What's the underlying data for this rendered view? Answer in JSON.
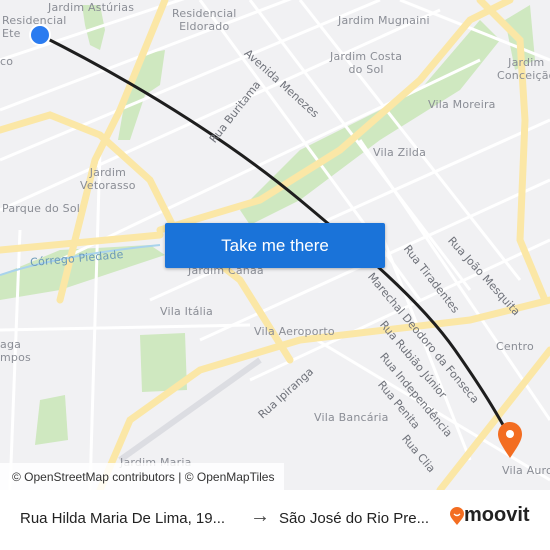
{
  "map": {
    "labels": {
      "residencial_ete": "Residencial\nEte",
      "jardim_asturias": "Jardim Astúrias",
      "residencial_eldorado": "Residencial\nEldorado",
      "jardim_mugnaini": "Jardim Mugnaini",
      "jardim_costa_do_sol": "Jardim Costa\ndo Sol",
      "jardim_conceicao": "Jardim\nConceição",
      "vila_moreira": "Vila Moreira",
      "vila_zilda": "Vila Zilda",
      "jardim_vetorasso": "Jardim\nVetorasso",
      "parque_do_sol": "Parque do Sol",
      "corrego_piedade": "Córrego Piedade",
      "jardim_canaa": "Jardim Canaã",
      "vila_italia": "Vila Itália",
      "vila_aeroporto": "Vila Aeroporto",
      "centro": "Centro",
      "vila_bancaria": "Vila Bancária",
      "vila_aurora": "Vila Auro",
      "aga_campos": "aga\nmpos",
      "co": "co",
      "jardim_maria": "Jardim Maria"
    },
    "streets": {
      "avenida_menezes": "Avenida Menezes",
      "rua_buritama": "Rua Buritama",
      "rua_tiradentes": "Rua Tiradentes",
      "rua_joao_mesquita": "Rua João Mesquita",
      "marechal_deodoro": "Marechal Deodoro da Fonseca",
      "rua_rubiao_junior": "Rua Rubião Júnior",
      "rua_independencia": "Rua Independência",
      "rua_penita": "Rua Penita",
      "rua_clia": "Rua Clia",
      "rua_ipiranga": "Rua Ipiranga"
    },
    "route_color": "#1e1e1e",
    "origin_color": "#2a7bf0",
    "destination_color": "#f36d21"
  },
  "cta": {
    "label": "Take me there",
    "color": "#1a73d9"
  },
  "attribution": "© OpenStreetMap contributors | © OpenMapTiles",
  "footer": {
    "from": "Rua Hilda Maria De Lima, 19...",
    "arrow": "→",
    "to": "São José do Rio Pre...",
    "brand": "moovit"
  }
}
